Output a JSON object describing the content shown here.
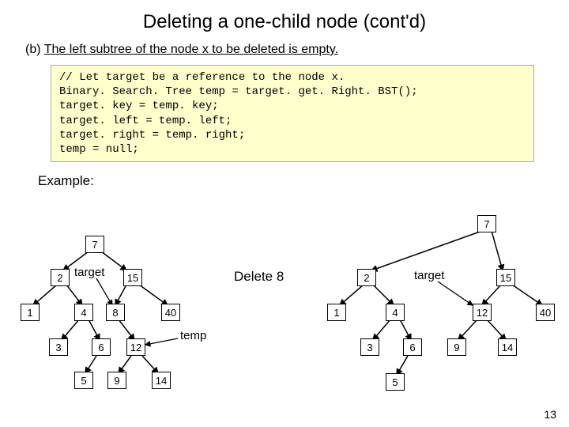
{
  "title": "Deleting a one-child node (cont'd)",
  "subhead_prefix": "(b) ",
  "subhead_underlined": "The left subtree of the node x to be deleted is empty.",
  "code": {
    "l1": "// Let target be a reference to the node x.",
    "l2": "Binary. Search. Tree temp = target. get. Right. BST();",
    "l3": "target. key = temp. key;",
    "l4": "target. left = temp. left;",
    "l5": "target. right = temp. right;",
    "l6": "temp = null;"
  },
  "example_label": "Example:",
  "delete_label": "Delete 8",
  "target_label": "target",
  "temp_label": "temp",
  "left_tree": {
    "n7": "7",
    "n2": "2",
    "n15": "15",
    "n1": "1",
    "n4": "4",
    "n8": "8",
    "n40": "40",
    "n3": "3",
    "n6": "6",
    "n12": "12",
    "n5": "5",
    "n9": "9",
    "n14": "14"
  },
  "right_tree": {
    "n7": "7",
    "n2": "2",
    "n15": "15",
    "n1": "1",
    "n4": "4",
    "n12": "12",
    "n40": "40",
    "n3": "3",
    "n6": "6",
    "n9": "9",
    "n14": "14",
    "n5": "5"
  },
  "page_number": "13"
}
